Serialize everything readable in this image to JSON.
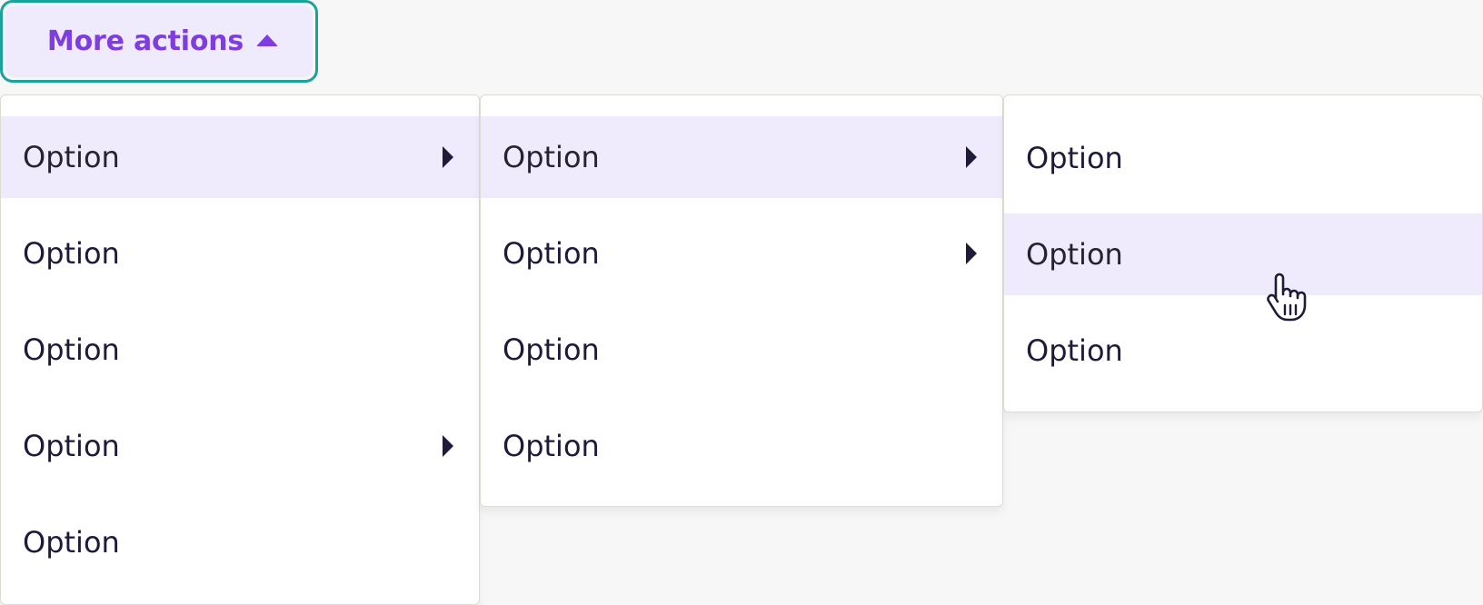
{
  "trigger": {
    "label": "More actions",
    "icon": "caret-up-icon",
    "accent_color": "#7f3ce0",
    "focus_ring_color": "#1aa39a"
  },
  "menus": [
    {
      "items": [
        {
          "label": "Option",
          "active": true,
          "has_submenu": true
        },
        {
          "label": "Option",
          "active": false,
          "has_submenu": false
        },
        {
          "label": "Option",
          "active": false,
          "has_submenu": false
        },
        {
          "label": "Option",
          "active": false,
          "has_submenu": true
        },
        {
          "label": "Option",
          "active": false,
          "has_submenu": false
        }
      ]
    },
    {
      "items": [
        {
          "label": "Option",
          "active": true,
          "has_submenu": true
        },
        {
          "label": "Option",
          "active": false,
          "has_submenu": true
        },
        {
          "label": "Option",
          "active": false,
          "has_submenu": false
        },
        {
          "label": "Option",
          "active": false,
          "has_submenu": false
        }
      ]
    },
    {
      "items": [
        {
          "label": "Option",
          "active": false,
          "has_submenu": false
        },
        {
          "label": "Option",
          "active": true,
          "has_submenu": false
        },
        {
          "label": "Option",
          "active": false,
          "has_submenu": false
        }
      ]
    }
  ],
  "cursor": {
    "icon": "pointer-hand-icon"
  },
  "colors": {
    "highlight": "#efebfd",
    "text": "#1e1a3a"
  }
}
